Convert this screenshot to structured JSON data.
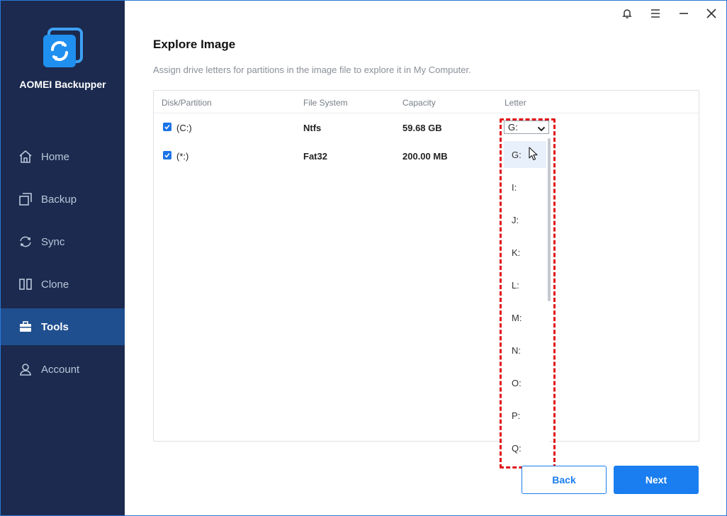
{
  "app": {
    "brand": "AOMEI Backupper"
  },
  "sidebar": {
    "items": [
      {
        "label": "Home",
        "icon": "home-icon"
      },
      {
        "label": "Backup",
        "icon": "backup-icon"
      },
      {
        "label": "Sync",
        "icon": "sync-icon"
      },
      {
        "label": "Clone",
        "icon": "clone-icon"
      },
      {
        "label": "Tools",
        "icon": "tools-icon",
        "active": true
      },
      {
        "label": "Account",
        "icon": "account-icon"
      }
    ]
  },
  "page": {
    "title": "Explore Image",
    "description": "Assign drive letters for partitions in the image file to explore it in My Computer."
  },
  "table": {
    "columns": [
      "Disk/Partition",
      "File System",
      "Capacity",
      "Letter"
    ],
    "rows": [
      {
        "name": "(C:)",
        "fs": "Ntfs",
        "capacity": "59.68 GB",
        "checked": true
      },
      {
        "name": "(*:)",
        "fs": "Fat32",
        "capacity": "200.00 MB",
        "checked": true
      }
    ]
  },
  "letter_select": {
    "selected": "G:",
    "options": [
      "G:",
      "I:",
      "J:",
      "K:",
      "L:",
      "M:",
      "N:",
      "O:",
      "P:",
      "Q:"
    ]
  },
  "buttons": {
    "back": "Back",
    "next": "Next"
  },
  "colors": {
    "sidebar": "#1b2a4e",
    "active": "#1f4f8f",
    "accent": "#1a7ef0",
    "highlight": "#e0141b"
  }
}
